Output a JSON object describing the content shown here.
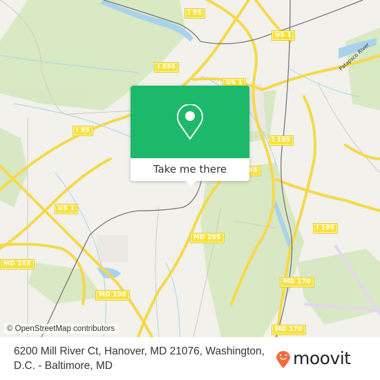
{
  "map": {
    "attribution": "© OpenStreetMap contributors",
    "road_labels": [
      {
        "id": "i95-top",
        "text": "I 95"
      },
      {
        "id": "us1-top",
        "text": "US 1"
      },
      {
        "id": "i895",
        "text": "I 895"
      },
      {
        "id": "us1-mid",
        "text": "US 1"
      },
      {
        "id": "i95-left",
        "text": "I 95"
      },
      {
        "id": "i195-upper",
        "text": "I 195"
      },
      {
        "id": "md295-upper",
        "text": "MD 295"
      },
      {
        "id": "us1-left",
        "text": "US 1"
      },
      {
        "id": "i195-lower",
        "text": "I 195"
      },
      {
        "id": "md295-lower",
        "text": "MD 295"
      },
      {
        "id": "md103",
        "text": "MD 103"
      },
      {
        "id": "md100",
        "text": "MD 100"
      },
      {
        "id": "md170-upper",
        "text": "MD 170"
      },
      {
        "id": "md170-lower",
        "text": "MD 170"
      }
    ],
    "water_labels": [
      {
        "id": "patapsco",
        "text": "Patapsco River"
      }
    ]
  },
  "popup": {
    "icon": "location-pin-icon",
    "button_label": "Take me there",
    "color": "#1db96a"
  },
  "footer": {
    "address": "6200 Mill River Ct, Hanover, MD 21076, Washington, D.C. - Baltimore, MD",
    "brand": "moovit",
    "brand_color": "#f26a3d"
  }
}
